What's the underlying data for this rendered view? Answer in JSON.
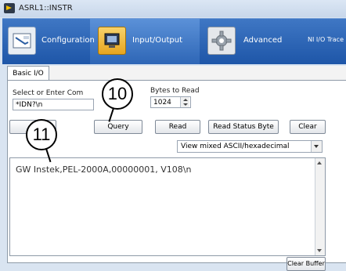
{
  "window": {
    "title": "ASRL1::INSTR"
  },
  "toolbar": {
    "items": [
      {
        "label": "Configuration",
        "icon": "configuration-icon"
      },
      {
        "label": "Input/Output",
        "icon": "input-output-icon"
      },
      {
        "label": "Advanced",
        "icon": "gear-icon"
      },
      {
        "label": "NI I/O Trace"
      }
    ]
  },
  "tabs": {
    "basic_io": "Basic I/O"
  },
  "io": {
    "command_label": "Select or Enter Com",
    "command_value": "*IDN?\\n",
    "bytes_label": "Bytes to Read",
    "bytes_value": "1024",
    "buttons": {
      "query": "Query",
      "read": "Read",
      "read_status_byte": "Read Status Byte",
      "clear": "Clear",
      "clear_buffer": "Clear Buffer"
    },
    "view_mode": "View mixed ASCII/hexadecimal",
    "response": "GW Instek,PEL-2000A,00000001, V108\\n"
  },
  "callouts": {
    "c10": "10",
    "c11": "11"
  }
}
